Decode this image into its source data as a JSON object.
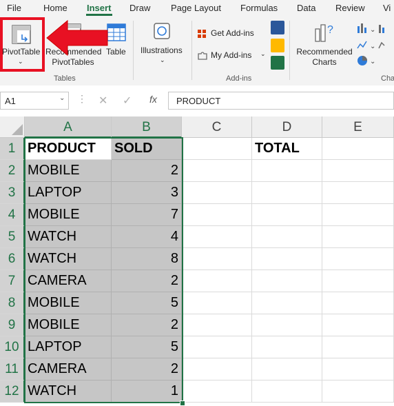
{
  "tabs": [
    "File",
    "Home",
    "Insert",
    "Draw",
    "Page Layout",
    "Formulas",
    "Data",
    "Review",
    "Vi"
  ],
  "ribbon": {
    "pivottable_label": "PivotTable",
    "recommended_pivot_label": "Recommended\nPivotTables",
    "table_label": "Table",
    "tables_group": "Tables",
    "illustrations_label": "Illustrations",
    "get_addins_label": "Get Add-ins",
    "my_addins_label": "My Add-ins",
    "addins_group": "Add-ins",
    "recommended_charts_label": "Recommended\nCharts",
    "charts_group": "Cha"
  },
  "namebox": {
    "value": "A1"
  },
  "formula_bar": {
    "fx": "fx",
    "value": "PRODUCT"
  },
  "columns": [
    "A",
    "B",
    "C",
    "D",
    "E"
  ],
  "rows": [
    {
      "num": "1",
      "a": "PRODUCT",
      "b": "SOLD",
      "d": "TOTAL"
    },
    {
      "num": "2",
      "a": "MOBILE",
      "b": "2"
    },
    {
      "num": "3",
      "a": "LAPTOP",
      "b": "3"
    },
    {
      "num": "4",
      "a": "MOBILE",
      "b": "7"
    },
    {
      "num": "5",
      "a": "WATCH",
      "b": "4"
    },
    {
      "num": "6",
      "a": "WATCH",
      "b": "8"
    },
    {
      "num": "7",
      "a": "CAMERA",
      "b": "2"
    },
    {
      "num": "8",
      "a": "MOBILE",
      "b": "5"
    },
    {
      "num": "9",
      "a": "MOBILE",
      "b": "2"
    },
    {
      "num": "10",
      "a": "LAPTOP",
      "b": "5"
    },
    {
      "num": "11",
      "a": "CAMERA",
      "b": "2"
    },
    {
      "num": "12",
      "a": "WATCH",
      "b": "1"
    }
  ],
  "colors": {
    "accent": "#217346",
    "highlight": "#e81123"
  }
}
